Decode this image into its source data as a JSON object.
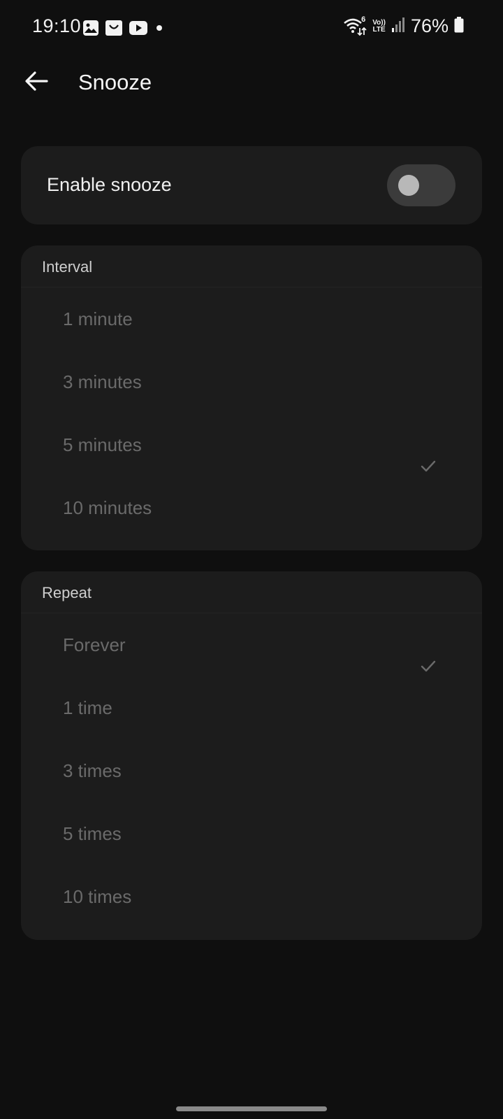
{
  "status_bar": {
    "time": "19:10",
    "battery": "76%",
    "volte_top": "Vo))",
    "volte_bottom": "LTE",
    "wifi_badge": "6",
    "left_icons": [
      "gallery-icon",
      "smile-app-icon",
      "youtube-icon",
      "notification-dot-icon"
    ],
    "right_icons": [
      "wifi-icon",
      "volte-icon",
      "signal-icon",
      "battery-icon"
    ]
  },
  "header": {
    "title": "Snooze",
    "back_icon": "arrow-left-icon"
  },
  "snooze_toggle": {
    "label": "Enable snooze",
    "enabled": false
  },
  "interval": {
    "title": "Interval",
    "options": [
      {
        "label": "1 minute",
        "selected": false
      },
      {
        "label": "3 minutes",
        "selected": false
      },
      {
        "label": "5 minutes",
        "selected": true
      },
      {
        "label": "10 minutes",
        "selected": false
      }
    ]
  },
  "repeat": {
    "title": "Repeat",
    "options": [
      {
        "label": "Forever",
        "selected": true
      },
      {
        "label": "1 time",
        "selected": false
      },
      {
        "label": "3 times",
        "selected": false
      },
      {
        "label": "5 times",
        "selected": false
      },
      {
        "label": "10 times",
        "selected": false
      }
    ]
  },
  "colors": {
    "background": "#0f0f0f",
    "card": "#1c1c1c",
    "disabled_text": "#6a6a6a",
    "toggle_track": "#3b3b3b",
    "toggle_knob": "#b8b8b8"
  }
}
